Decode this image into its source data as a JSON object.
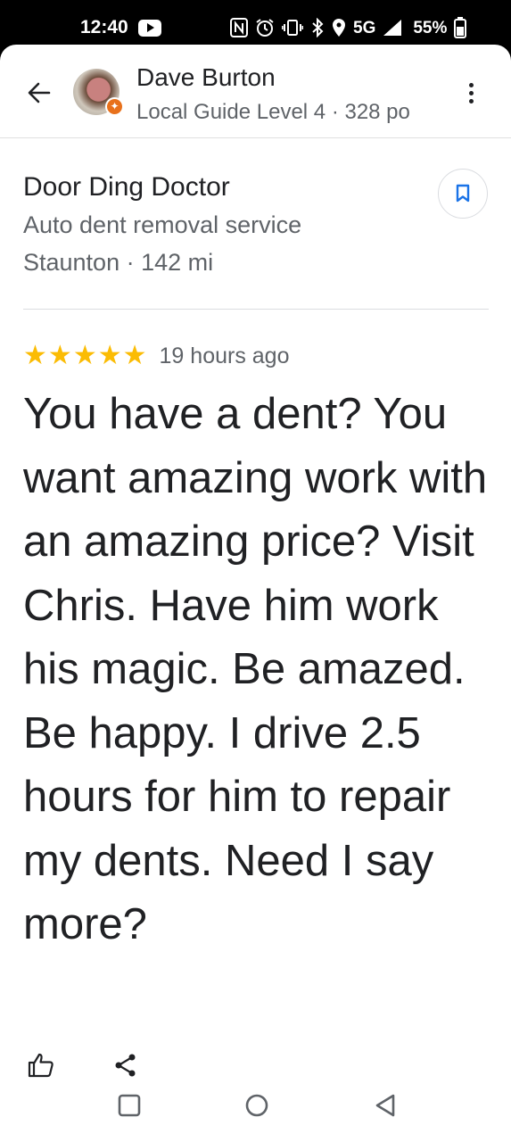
{
  "status_bar": {
    "time": "12:40",
    "network": "5G",
    "battery_percent": "55%",
    "icons": [
      "youtube-icon",
      "nfc-icon",
      "alarm-icon",
      "vibrate-icon",
      "bluetooth-icon",
      "location-icon",
      "signal-icon",
      "battery-icon"
    ]
  },
  "header": {
    "reviewer_name": "Dave Burton",
    "reviewer_subtitle": "Local Guide Level 4 · 328 po"
  },
  "place": {
    "name": "Door Ding Doctor",
    "category": "Auto dent removal service",
    "location": "Staunton · 142 mi"
  },
  "review": {
    "rating": 5,
    "time": "19 hours ago",
    "text": "You have a dent? You want amazing work with an amazing price? Visit Chris. Have him work his magic. Be amazed. Be happy. I drive 2.5 hours for him to repair my dents. Need I say more?"
  },
  "colors": {
    "star": "#fbbc04",
    "save_accent": "#1a73e8",
    "badge": "#e8711c"
  }
}
